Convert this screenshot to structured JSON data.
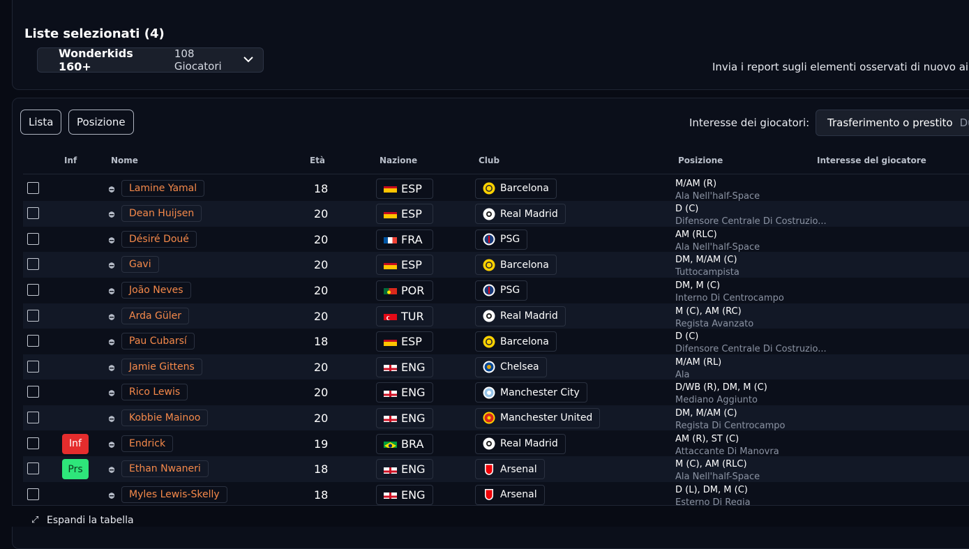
{
  "header": {
    "title": "Liste selezionati (4)",
    "list_name": "Wonderkids 160+",
    "list_count": "108 Giocatori",
    "report_text": "Invia i report sugli elementi osservati di nuovo ai Mes"
  },
  "toolbar": {
    "tab_lista": "Lista",
    "tab_posizione": "Posizione",
    "interest_label": "Interesse dei giocatori:",
    "interest_value": "Trasferimento o prestito",
    "interest_sub": "Dub"
  },
  "columns": {
    "inf": "Inf",
    "name": "Nome",
    "age": "Età",
    "nation": "Nazione",
    "club": "Club",
    "position": "Posizione",
    "interest": "Interesse del giocatore"
  },
  "players": [
    {
      "name": "Lamine Yamal",
      "age": "18",
      "nation": "ESP",
      "club": "Barcelona",
      "position": "M/AM (R)",
      "role": "Ala Nell'half-Space",
      "badge": ""
    },
    {
      "name": "Dean Huijsen",
      "age": "20",
      "nation": "ESP",
      "club": "Real Madrid",
      "position": "D (C)",
      "role": "Difensore Centrale Di Costruzio...",
      "badge": ""
    },
    {
      "name": "Désiré Doué",
      "age": "20",
      "nation": "FRA",
      "club": "PSG",
      "position": "AM (RLC)",
      "role": "Ala Nell'half-Space",
      "badge": ""
    },
    {
      "name": "Gavi",
      "age": "20",
      "nation": "ESP",
      "club": "Barcelona",
      "position": "DM, M/AM (C)",
      "role": "Tuttocampista",
      "badge": ""
    },
    {
      "name": "João Neves",
      "age": "20",
      "nation": "POR",
      "club": "PSG",
      "position": "DM, M (C)",
      "role": "Interno Di Centrocampo",
      "badge": ""
    },
    {
      "name": "Arda Güler",
      "age": "20",
      "nation": "TUR",
      "club": "Real Madrid",
      "position": "M (C), AM (RC)",
      "role": "Regista Avanzato",
      "badge": ""
    },
    {
      "name": "Pau Cubarsí",
      "age": "18",
      "nation": "ESP",
      "club": "Barcelona",
      "position": "D (C)",
      "role": "Difensore Centrale Di Costruzio...",
      "badge": ""
    },
    {
      "name": "Jamie Gittens",
      "age": "20",
      "nation": "ENG",
      "club": "Chelsea",
      "position": "M/AM (RL)",
      "role": "Ala",
      "badge": ""
    },
    {
      "name": "Rico Lewis",
      "age": "20",
      "nation": "ENG",
      "club": "Manchester City",
      "position": "D/WB (R), DM, M (C)",
      "role": "Mediano Aggiunto",
      "badge": ""
    },
    {
      "name": "Kobbie Mainoo",
      "age": "20",
      "nation": "ENG",
      "club": "Manchester United",
      "position": "DM, M/AM (C)",
      "role": "Regista Di Centrocampo",
      "badge": ""
    },
    {
      "name": "Endrick",
      "age": "19",
      "nation": "BRA",
      "club": "Real Madrid",
      "position": "AM (R), ST (C)",
      "role": "Attaccante Di Manovra",
      "badge": "Inf"
    },
    {
      "name": "Ethan Nwaneri",
      "age": "18",
      "nation": "ENG",
      "club": "Arsenal",
      "position": "M (C), AM (RLC)",
      "role": "Ala Nell'half-Space",
      "badge": "Prs"
    },
    {
      "name": "Myles Lewis-Skelly",
      "age": "18",
      "nation": "ENG",
      "club": "Arsenal",
      "position": "D (L), DM, M (C)",
      "role": "Esterno Di Regia",
      "badge": ""
    }
  ],
  "footer": {
    "expand_label": "Espandi la tabella"
  },
  "colors": {
    "accent_name": "#f5894a",
    "badge_inf": "#e52d2d",
    "badge_prs": "#2ee67a",
    "row_alt": "#121826"
  }
}
